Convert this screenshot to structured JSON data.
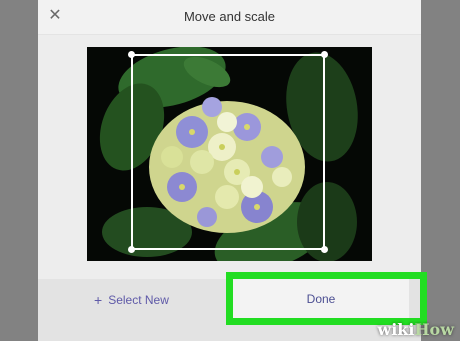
{
  "dialog": {
    "title": "Move and scale",
    "close_icon": "close-icon",
    "close_glyph": "✕"
  },
  "footer": {
    "select_new_icon": "plus-icon",
    "select_new_glyph": "+",
    "select_new_label": "Select New",
    "done_label": "Done"
  },
  "colors": {
    "accent": "#5f5aa8",
    "highlight": "#22dd22",
    "title_bar": "#f2f2f2"
  },
  "watermark": {
    "part1": "wiki",
    "part2": "How"
  }
}
